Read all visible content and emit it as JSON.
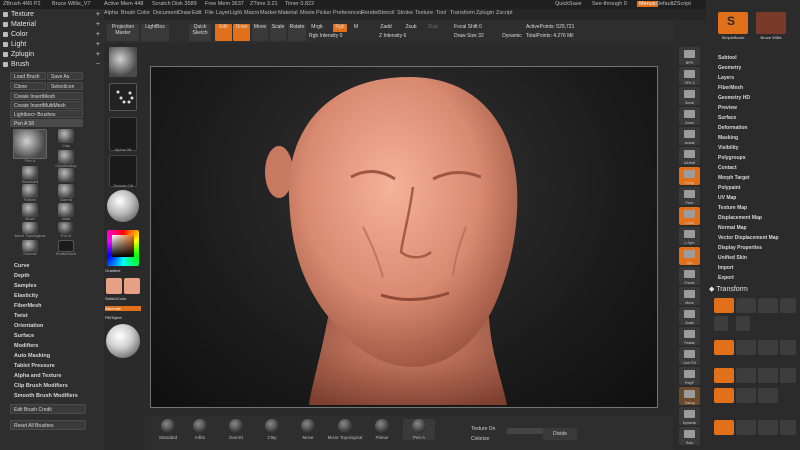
{
  "titlebar": {
    "app": "ZBrush 4R6 P2",
    "document": "Bruce Willis_V7",
    "active_mem": "Active Mem 448",
    "scratch_disk": "Scratch Disk 3589",
    "free_mem": "Free Mem 3637",
    "ztime": "ZTime 3.21",
    "timer": "Timer 0.822",
    "quicksave": "QuickSave",
    "seethrough": "See-through 0",
    "menus_btn": "Menus",
    "default_script": "DefaultZScript"
  },
  "menubar": {
    "items": [
      "Alpha",
      "Brush",
      "Color",
      "Document",
      "Draw",
      "Edit",
      "File",
      "Layer",
      "Light",
      "Macro",
      "Marker",
      "Material",
      "Movie",
      "Picker",
      "Preferences",
      "Render",
      "Stencil",
      "Stroke",
      "Texture",
      "Tool",
      "Transform",
      "Zplugin",
      "Zscript"
    ]
  },
  "left_palettes": {
    "items": [
      "Texture",
      "Material",
      "Color",
      "Light",
      "Zplugin",
      "Brush"
    ]
  },
  "brush_panel": {
    "load": "Load Brush",
    "save_as": "Save As",
    "clone": "Clone",
    "selection": "SelectIcon",
    "create_insert": "Create InsertMesh",
    "create_multi": "Create InsertMultiMesh",
    "lightbox": "Lightbox> Brushes",
    "current_brush": "Pen A 58",
    "thumbs": [
      "Pen A",
      "Clay",
      "ClayBuildup",
      "Standard",
      "Flatten",
      "DamSt",
      "Move",
      "Inflat",
      "Move Topological",
      "Pen A",
      "Smooth",
      "SnakeHook"
    ],
    "subpalettes": [
      "Curve",
      "Depth",
      "Samples",
      "Elasticity",
      "FiberMesh",
      "Twist",
      "Orientation",
      "Surface",
      "Modifiers",
      "Auto Masking",
      "Tablet Pressure",
      "Alpha and Texture",
      "Clip Brush Modifiers",
      "Smooth Brush Modifiers"
    ],
    "edit_credit": "Edit Brush Credit",
    "reset_all": "Reset All Brushes"
  },
  "left_shelf": {
    "alpha_label": "Alpha Off",
    "texture_label": "Texture Off",
    "gradient": "Gradient",
    "switch_color": "SwitchColor",
    "alternate": "Alternate",
    "fill_object": "FillObject"
  },
  "top_shelf": {
    "projection": "Projection Master",
    "lightbox": "LightBox",
    "quick_sketch": "Quick Sketch",
    "edit": "Edit",
    "draw": "Draw",
    "move": "Move",
    "scale": "Scale",
    "rotate": "Rotate",
    "mrgb": "Mrgb",
    "rgb": "Rgb",
    "m": "M",
    "zadd": "Zadd",
    "zsub": "Zsub",
    "zcut": "Zcut",
    "rgb_intensity": "Rgb Intensity 0",
    "z_intensity": "Z Intensity 6",
    "focal_shift": "Focal Shift 0",
    "draw_size": "Draw Size 32",
    "dynamic": "Dynamic",
    "active_points": "ActivePoints: 529,721",
    "total_points": "TotalPoints: 4.276 Mil"
  },
  "bottom_shelf": {
    "brushes": [
      "Standard",
      "Inflat",
      "DamSt",
      "Clay",
      "Move",
      "Move Topological",
      "Planar",
      "Pen A"
    ],
    "texture_on": "Texture On",
    "colorize": "Colorize",
    "divide": "Divide"
  },
  "right_shelf": {
    "buttons": [
      "BPR",
      "SPix 3",
      "Scroll",
      "Zoom",
      "Actual",
      "AAHalf",
      "Persp",
      "Floor",
      "Local",
      "L.Sym",
      "Xyz",
      "Frame",
      "Move",
      "Scale",
      "Rotate",
      "Line Fill",
      "PolyF",
      "Transp",
      "Dynamic",
      "Solo"
    ]
  },
  "right_tray": {
    "lightbox_tools": "Lightbox> Tools",
    "tool_names": [
      "SimpleBrush",
      "Bruce Willis"
    ],
    "subpalettes": [
      "Subtool",
      "Geometry",
      "Layers",
      "FiberMesh",
      "Geometry HD",
      "Preview",
      "Surface",
      "Deformation",
      "Masking",
      "Visibility",
      "Polygroups",
      "Contact",
      "Morph Target",
      "Polypaint",
      "UV Map",
      "Texture Map",
      "Displacement Map",
      "Normal Map",
      "Vector Displacement Map",
      "Display Properties",
      "Unified Skin",
      "Import",
      "Export"
    ],
    "transform_title": "Transform"
  }
}
